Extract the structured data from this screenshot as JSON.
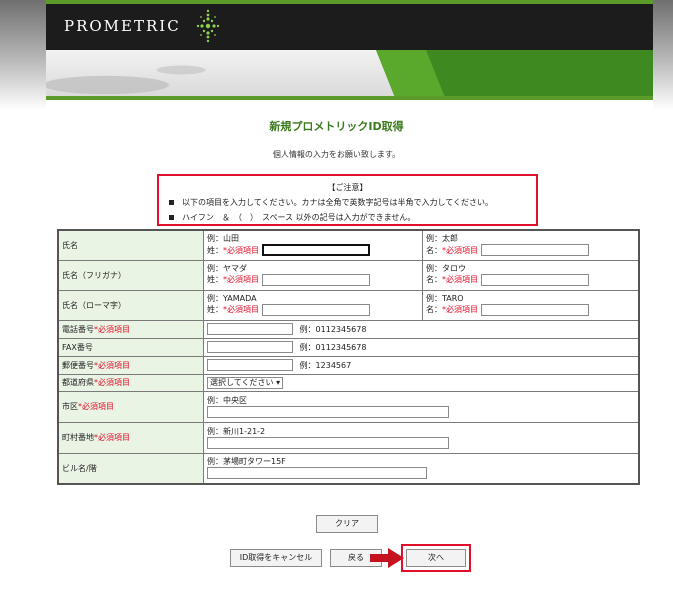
{
  "header": {
    "logo_text": "PROMETRIC",
    "colors": {
      "brand_green": "#5c9b2a",
      "title_green": "#3a7a1c",
      "alert_red": "#e0102a",
      "label_bg": "#eaf4e4"
    }
  },
  "page": {
    "title": "新規プロメトリックID取得",
    "subtitle": "個人情報の入力をお願い致します。"
  },
  "notice": {
    "title": "【ご注意】",
    "items": [
      "以下の項目を入力してください。カナは全角で英数字記号は半角で入力してください。",
      "ハイフン　＆　（　）　スペース 以外の記号は入力ができません。"
    ]
  },
  "form": {
    "required_mark": "*必須項目",
    "name": {
      "label": "氏名",
      "last_example": "例：山田",
      "last_prefix": "姓：",
      "first_example": "例：太郎",
      "first_prefix": "名："
    },
    "kana": {
      "label": "氏名（フリガナ）",
      "last_example": "例：ヤマダ",
      "last_prefix": "姓：",
      "first_example": "例：タロウ",
      "first_prefix": "名："
    },
    "roman": {
      "label": "氏名（ローマ字）",
      "last_example": "例：YAMADA",
      "last_prefix": "姓：",
      "first_example": "例：TARO",
      "first_prefix": "名："
    },
    "phone": {
      "label": "電話番号",
      "example": "例：0112345678"
    },
    "fax": {
      "label": "FAX番号",
      "example": "例：0112345678"
    },
    "postal": {
      "label": "郵便番号",
      "example": "例：1234567"
    },
    "prefecture": {
      "label": "都道府県",
      "selected": "選択してください"
    },
    "city": {
      "label": "市区",
      "example": "例：中央区"
    },
    "street": {
      "label": "町村番地",
      "example": "例：新川1-21-2"
    },
    "building": {
      "label": "ビル名/階",
      "example": "例：茅場町タワー15F"
    }
  },
  "buttons": {
    "clear": "クリア",
    "cancel": "ID取得をキャンセル",
    "back": "戻る",
    "next": "次へ"
  }
}
